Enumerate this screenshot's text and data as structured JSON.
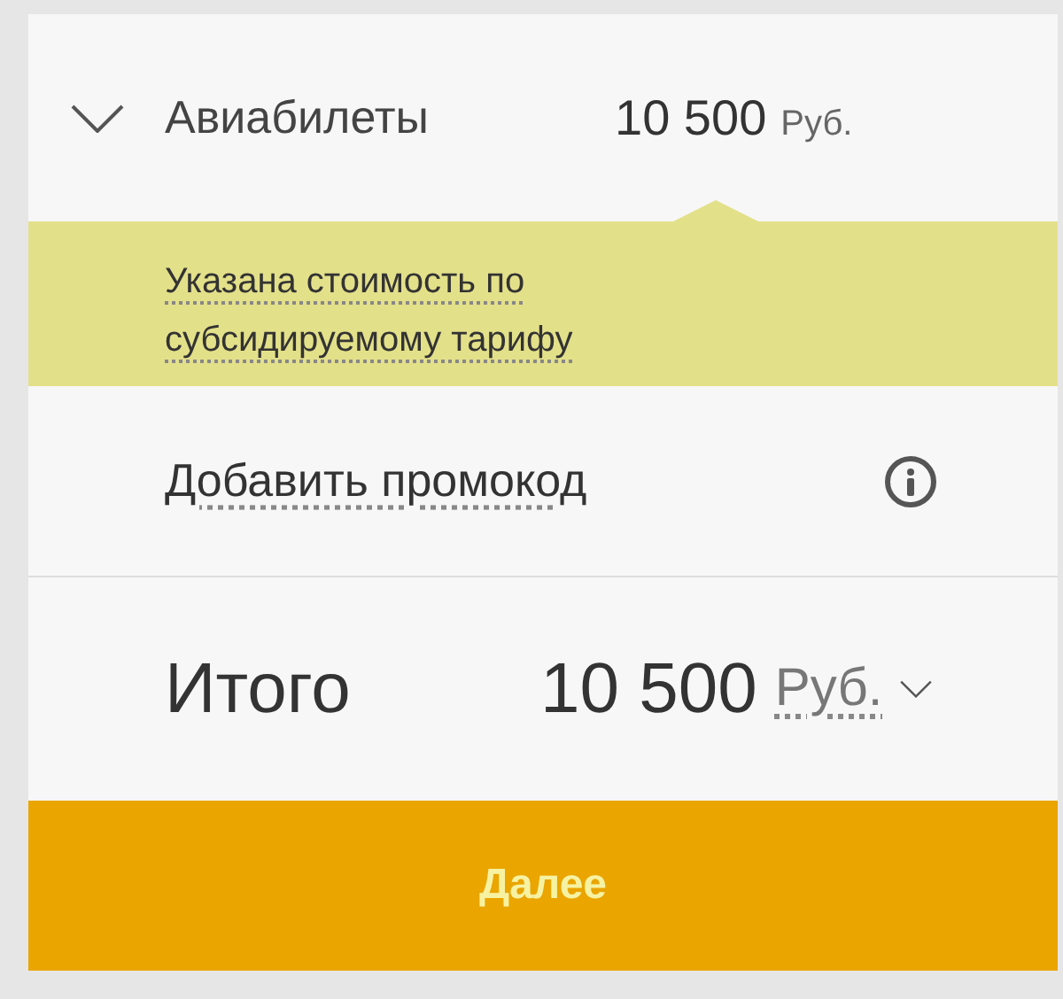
{
  "flights": {
    "label": "Авиабилеты",
    "amount": "10 500",
    "currency": "Руб.",
    "expanded": true
  },
  "notice": {
    "text": "Указана стоимость по субсидируемому тарифу"
  },
  "promo": {
    "label": "Добавить промокод"
  },
  "total": {
    "label": "Итого",
    "amount": "10 500",
    "currency": "Руб."
  },
  "buttons": [
    "Далее"
  ]
}
